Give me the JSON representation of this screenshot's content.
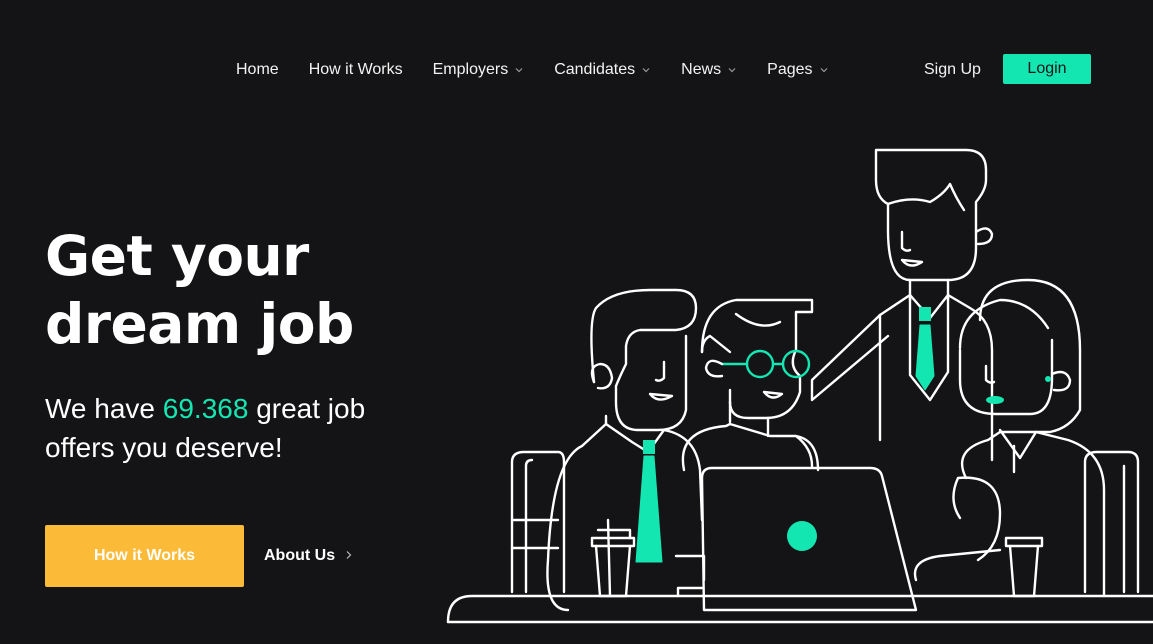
{
  "nav": {
    "items": [
      {
        "label": "Home",
        "dropdown": false
      },
      {
        "label": "How it Works",
        "dropdown": false
      },
      {
        "label": "Employers",
        "dropdown": true
      },
      {
        "label": "Candidates",
        "dropdown": true
      },
      {
        "label": "News",
        "dropdown": true
      },
      {
        "label": "Pages",
        "dropdown": true
      }
    ],
    "signup_label": "Sign Up",
    "login_label": "Login"
  },
  "hero": {
    "title_line1": "Get your",
    "title_line2": "dream job",
    "sub_prefix": "We have ",
    "job_count": "69.368",
    "sub_suffix": " great job",
    "sub_line2": "offers you deserve!",
    "primary_button": "How it Works",
    "secondary_link": "About Us",
    "secondary_icon": "chevron-right-icon"
  },
  "colors": {
    "background": "#141416",
    "accent": "#14e6b1",
    "primary_button": "#fbbb38",
    "text": "#ffffff"
  },
  "illustration": {
    "name": "team-working-at-laptop-illustration"
  }
}
